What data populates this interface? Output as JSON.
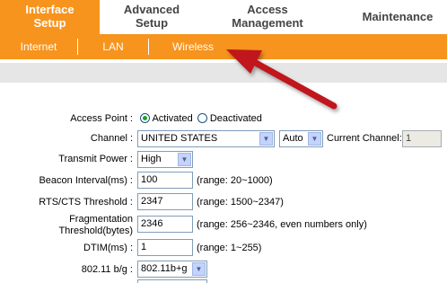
{
  "main_tabs": [
    {
      "line1": "Interface",
      "line2": "Setup"
    },
    {
      "line1": "Advanced",
      "line2": "Setup"
    },
    {
      "line1": "Access",
      "line2": "Management"
    },
    {
      "line1": "Maintenance",
      "line2": ""
    }
  ],
  "sub_tabs": [
    "Internet",
    "LAN",
    "Wireless"
  ],
  "form": {
    "access_point": {
      "label": "Access Point :",
      "opt_activated": "Activated",
      "opt_deactivated": "Deactivated",
      "selected": "Activated"
    },
    "channel": {
      "label": "Channel :",
      "value": "UNITED STATES",
      "auto_value": "Auto",
      "current_label": "Current Channel:",
      "current_value": "1"
    },
    "transmit_power": {
      "label": "Transmit Power :",
      "value": "High"
    },
    "beacon_interval": {
      "label": "Beacon Interval(ms) :",
      "value": "100",
      "range": "(range: 20~1000)"
    },
    "rts_threshold": {
      "label": "RTS/CTS Threshold :",
      "value": "2347",
      "range": "(range: 1500~2347)"
    },
    "frag_threshold": {
      "label_line1": "Fragmentation",
      "label_line2": "Threshold(bytes)",
      "value": "2346",
      "range": "(range: 256~2346, even numbers only)"
    },
    "dtim": {
      "label": "DTIM(ms) :",
      "value": "1",
      "range": "(range: 1~255)"
    },
    "mode_80211": {
      "label": "802.11 b/g :",
      "value": "802.11b+g"
    }
  },
  "colors": {
    "accent": "#f7941d",
    "arrow": "#c0141b"
  }
}
